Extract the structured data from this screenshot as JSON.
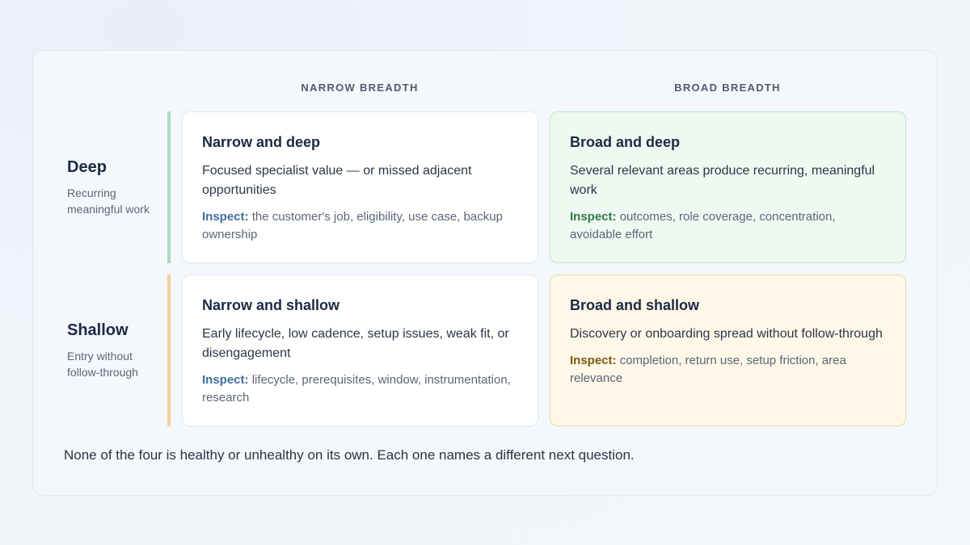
{
  "columns": {
    "narrow": "NARROW BREADTH",
    "broad": "BROAD BREADTH"
  },
  "rows": {
    "deep": {
      "title": "Deep",
      "subtitle": "Recurring meaningful work"
    },
    "shallow": {
      "title": "Shallow",
      "subtitle": "Entry without follow-through"
    }
  },
  "quadrants": {
    "narrow_deep": {
      "title": "Narrow and deep",
      "description": "Focused specialist value — or missed adjacent opportunities",
      "inspect_label": "Inspect:",
      "inspect_text": "the customer's job, eligibility, use case, backup ownership"
    },
    "broad_deep": {
      "title": "Broad and deep",
      "description": "Several relevant areas produce recurring, meaningful work",
      "inspect_label": "Inspect:",
      "inspect_text": "outcomes, role coverage, concentration, avoidable effort"
    },
    "narrow_shallow": {
      "title": "Narrow and shallow",
      "description": "Early lifecycle, low cadence, setup issues, weak fit, or disengagement",
      "inspect_label": "Inspect:",
      "inspect_text": "lifecycle, prerequisites, window, instrumentation, research"
    },
    "broad_shallow": {
      "title": "Broad and shallow",
      "description": "Discovery or onboarding spread without follow-through",
      "inspect_label": "Inspect:",
      "inspect_text": "completion, return use, setup friction, area relevance"
    }
  },
  "footer": "None of the four is healthy or unhealthy on its own. Each one names a different next question.",
  "colors": {
    "deep_accent": "#a9dcbd",
    "shallow_accent": "#eed29c",
    "broad_deep_bg": "#eef9f2",
    "broad_shallow_bg": "#fff7e8"
  }
}
